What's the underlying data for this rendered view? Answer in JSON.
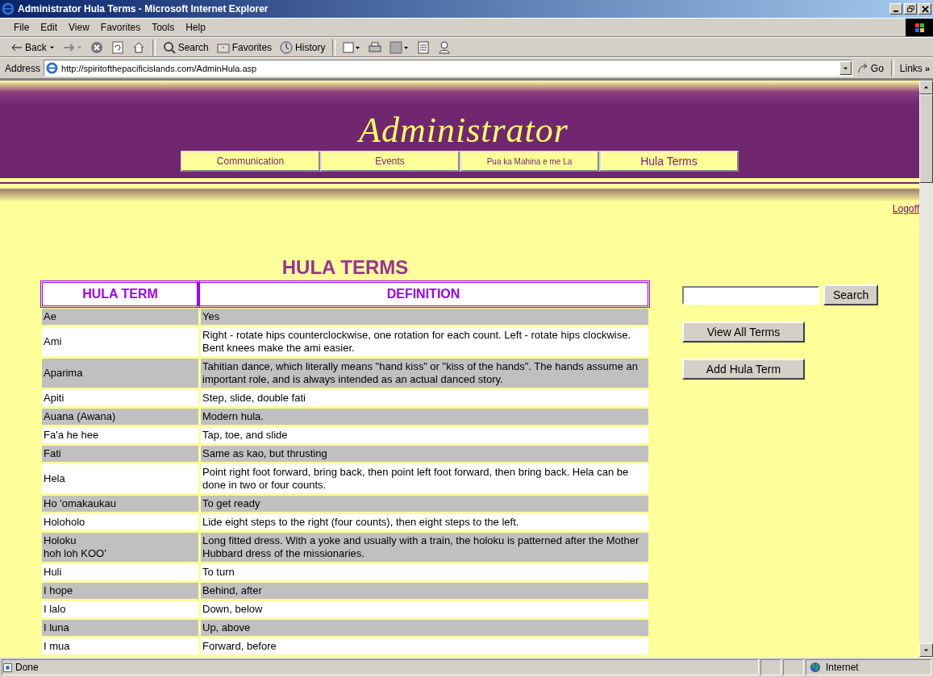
{
  "window": {
    "title": "Administrator Hula Terms - Microsoft Internet Explorer"
  },
  "menu": [
    "File",
    "Edit",
    "View",
    "Favorites",
    "Tools",
    "Help"
  ],
  "toolbar": {
    "back": "Back",
    "search": "Search",
    "favorites": "Favorites",
    "history": "History"
  },
  "address": {
    "label": "Address",
    "url": "http://spiritofthepacificislands.com/AdminHula.asp",
    "go": "Go",
    "links": "Links",
    "more": "»"
  },
  "page": {
    "heading": "Administrator",
    "nav": [
      {
        "label": "Communication",
        "selected": false
      },
      {
        "label": "Events",
        "selected": false
      },
      {
        "label": "Pua ka Mahina e me La",
        "selected": false,
        "small": true
      },
      {
        "label": "Hula Terms",
        "selected": true
      }
    ],
    "logoff": "Logoff",
    "title": "HULA TERMS",
    "table": {
      "columns": [
        "HULA TERM",
        "DEFINITION"
      ],
      "rows": [
        {
          "term": "Ae",
          "definition": "Yes"
        },
        {
          "term": "Ami",
          "definition": "Right - rotate hips counterclockwise, one rotation for each count. Left - rotate hips clockwise. Bent knees make the ami easier."
        },
        {
          "term": "Aparima",
          "definition": "Tahitian dance, which literally means \"hand kiss\" or \"kiss of the hands\". The hands assume an important role, and is always intended as an actual danced story."
        },
        {
          "term": "Apiti",
          "definition": "Step, slide, double fati"
        },
        {
          "term": "Auana (Awana)",
          "definition": "Modern hula."
        },
        {
          "term": "Fa'a he hee",
          "definition": "Tap, toe, and slide"
        },
        {
          "term": "Fati",
          "definition": "Same as kao, but thrusting"
        },
        {
          "term": "Hela",
          "definition": "Point right foot forward, bring back, then point left foot forward, then bring back. Hela can be done in two or four counts."
        },
        {
          "term": "Ho 'omakaukau",
          "definition": "To get ready"
        },
        {
          "term": "Holoholo",
          "definition": "Lide eight steps to the right (four counts), then eight steps to the left."
        },
        {
          "term": "Holoku\nhoh loh KOO'",
          "definition": "Long fitted dress. With a yoke and usually with a train, the holoku is patterned after the Mother Hubbard dress of the missionaries."
        },
        {
          "term": "Huli",
          "definition": "To turn"
        },
        {
          "term": "I hope",
          "definition": "Behind, after"
        },
        {
          "term": "I lalo",
          "definition": "Down, below"
        },
        {
          "term": "I luna",
          "definition": "Up, above"
        },
        {
          "term": "I mua",
          "definition": "Forward, before"
        }
      ]
    },
    "search_button": "Search",
    "buttons": [
      "View All Terms",
      "Add Hula Term"
    ]
  },
  "status_bar": {
    "text": "Done",
    "zone": "Internet"
  }
}
